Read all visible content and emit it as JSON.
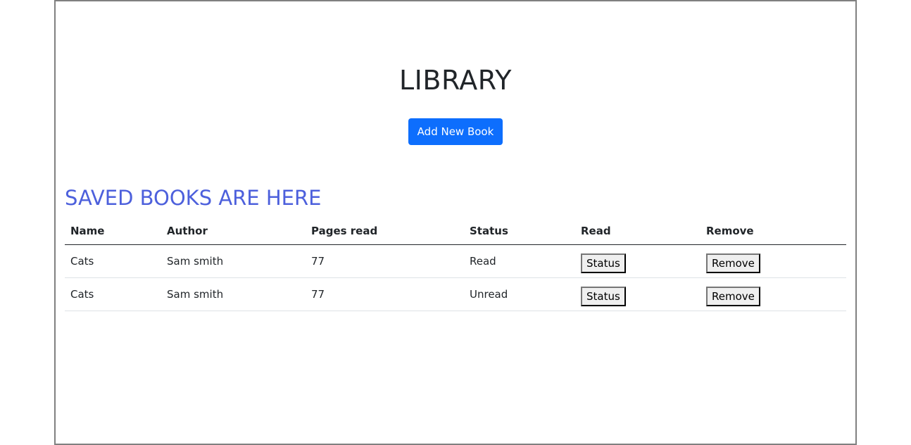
{
  "header": {
    "title": "LIBRARY",
    "add_button_label": "Add New Book"
  },
  "library": {
    "heading": "SAVED BOOKS ARE HERE",
    "columns": [
      "Name",
      "Author",
      "Pages read",
      "Status",
      "Read",
      "Remove"
    ],
    "rows": [
      {
        "name": "Cats",
        "author": "Sam smith",
        "pages": "77",
        "status": "Read",
        "read_button": "Status",
        "remove_button": "Remove"
      },
      {
        "name": "Cats",
        "author": "Sam smith",
        "pages": "77",
        "status": "Unread",
        "read_button": "Status",
        "remove_button": "Remove"
      }
    ]
  },
  "colors": {
    "primary_button": "#0d6efd",
    "heading_accent": "#4d60dc",
    "frame_border": "#808080"
  }
}
